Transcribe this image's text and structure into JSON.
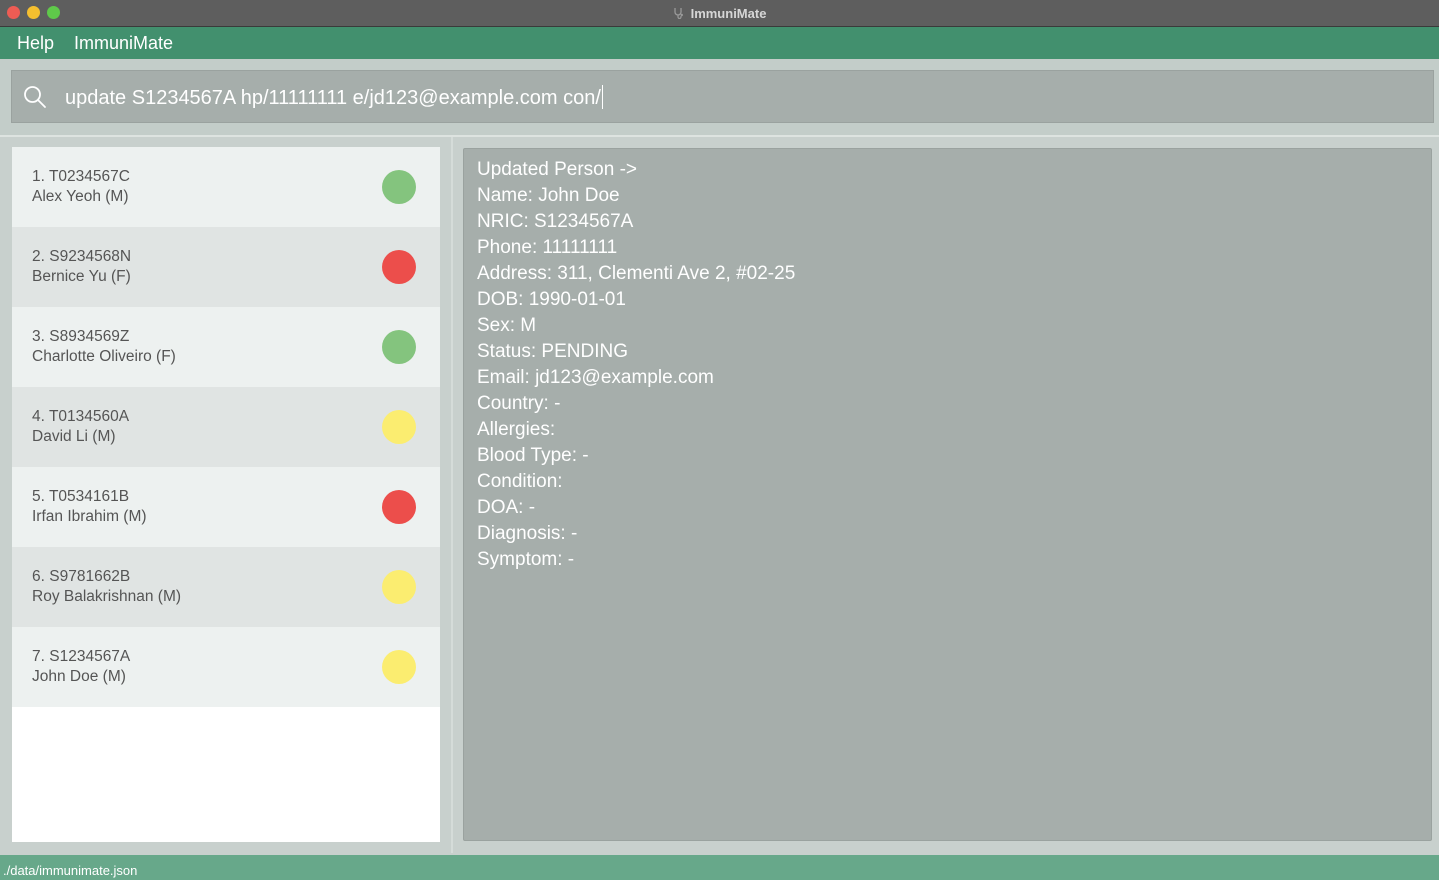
{
  "window": {
    "title": "ImmuniMate"
  },
  "menu": {
    "items": [
      "Help",
      "ImmuniMate"
    ]
  },
  "command": {
    "value": "update S1234567A hp/11111111 e/jd123@example.com con/"
  },
  "persons": [
    {
      "index": "1.",
      "nric": "T0234567C",
      "name": "Alex Yeoh (M)",
      "status_color": "#84c47e"
    },
    {
      "index": "2.",
      "nric": "S9234568N",
      "name": "Bernice Yu (F)",
      "status_color": "#ec4e4b"
    },
    {
      "index": "3.",
      "nric": "S8934569Z",
      "name": "Charlotte Oliveiro (F)",
      "status_color": "#84c47e"
    },
    {
      "index": "4.",
      "nric": "T0134560A",
      "name": "David Li (M)",
      "status_color": "#fbed70"
    },
    {
      "index": "5.",
      "nric": "T0534161B",
      "name": "Irfan Ibrahim (M)",
      "status_color": "#ec4e4b"
    },
    {
      "index": "6.",
      "nric": "S9781662B",
      "name": "Roy Balakrishnan (M)",
      "status_color": "#fbed70"
    },
    {
      "index": "7.",
      "nric": "S1234567A",
      "name": "John Doe (M)",
      "status_color": "#fbed70"
    }
  ],
  "result": {
    "lines": [
      "Updated Person ->",
      "Name: John Doe",
      "NRIC: S1234567A",
      "Phone: 11111111",
      "Address: 311, Clementi Ave 2, #02-25",
      "DOB: 1990-01-01",
      "Sex: M",
      "Status: PENDING",
      "Email: jd123@example.com",
      "Country: -",
      "Allergies:",
      "Blood Type: -",
      "Condition:",
      "DOA: -",
      "Diagnosis: -",
      "Symptom: -"
    ]
  },
  "status": {
    "path": "./data/immunimate.json"
  }
}
